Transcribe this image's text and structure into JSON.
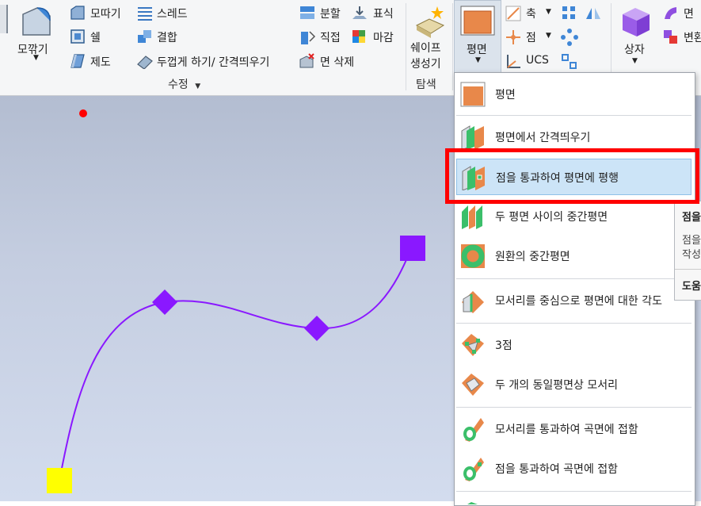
{
  "ribbon": {
    "modify": {
      "fillet_label": "모깎기",
      "chamfer_label": "모따기",
      "shell_label": "쉘",
      "draft_label": "제도",
      "thread_label": "스레드",
      "combine_label": "결합",
      "thicken_label": "두껍게 하기/ 간격띄우기",
      "split_label": "분할",
      "direct_label": "직접",
      "delete_face_label": "면 삭제",
      "emboss_label": "표식",
      "decal_label": "마감",
      "group_label": "수정"
    },
    "explore": {
      "shape_generator_line1": "쉐이프",
      "shape_generator_line2": "생성기",
      "group_label": "탐색"
    },
    "work_features": {
      "plane_label": "평면",
      "axis_label": "축",
      "point_label": "점",
      "ucs_label": "UCS"
    },
    "primitives": {
      "box_label": "상자"
    },
    "freeform": {
      "face_label": "면",
      "convert_label": "변환"
    }
  },
  "plane_menu": {
    "items": [
      {
        "label": "평면"
      },
      {
        "label": "평면에서 간격띄우기"
      },
      {
        "label": "점을 통과하여 평면에 평행"
      },
      {
        "label": "두 평면 사이의 중간평면"
      },
      {
        "label": "원환의 중간평면"
      },
      {
        "label": "모서리를 중심으로 평면에 대한 각도"
      },
      {
        "label": "3점"
      },
      {
        "label": "두 개의 동일평면상 모서리"
      },
      {
        "label": "모서리를 통과하여 곡면에 접함"
      },
      {
        "label": "점을 통과하여 곡면에 접함"
      }
    ],
    "highlighted_index": 2
  },
  "tooltip": {
    "line1": "점을",
    "line2": "점을",
    "line3": "작성",
    "line4": "도움"
  },
  "colors": {
    "spline": "#8a18ff",
    "start_point": "#ffff00",
    "end_point": "#8a18ff",
    "origin_dot": "#ff0000",
    "highlight_border": "#ff0000",
    "menu_highlight": "#cce4f7"
  }
}
